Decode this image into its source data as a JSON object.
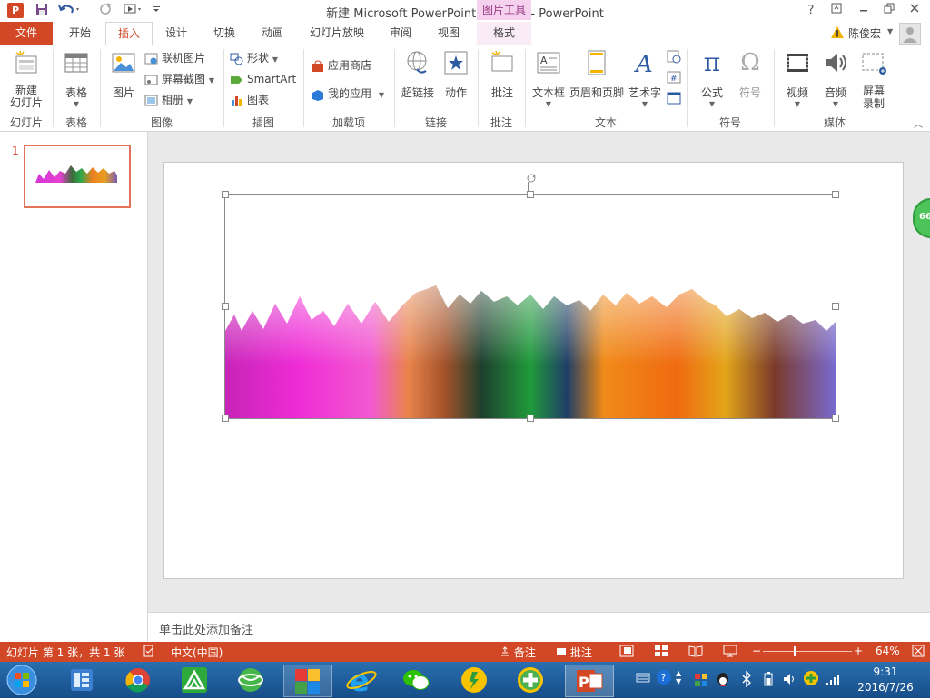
{
  "titlebar": {
    "title": "新建 Microsoft PowerPoint 演示文稿 - PowerPoint",
    "app_logo": "P",
    "context_tab": "图片工具",
    "help": "?",
    "icons": [
      "save-icon",
      "undo-icon",
      "redo-icon",
      "present-icon",
      "customize-qat-icon",
      "help-icon",
      "ribbon-display-icon",
      "minimize-icon",
      "restore-icon",
      "close-icon"
    ]
  },
  "tabs": [
    "文件",
    "开始",
    "插入",
    "设计",
    "切换",
    "动画",
    "幻灯片放映",
    "审阅",
    "视图",
    "格式"
  ],
  "active_tab": "插入",
  "user": {
    "name": "陈俊宏"
  },
  "ribbon": {
    "groups": {
      "slides": {
        "label": "幻灯片",
        "new_slide": "新建\n幻灯片"
      },
      "tables": {
        "label": "表格",
        "table": "表格"
      },
      "images": {
        "label": "图像",
        "picture": "图片",
        "online_picture": "联机图片",
        "screenshot": "屏幕截图",
        "album": "相册"
      },
      "illustrations": {
        "label": "插图",
        "shapes": "形状",
        "smartart": "SmartArt",
        "chart": "图表"
      },
      "addins": {
        "label": "加载项",
        "store": "应用商店",
        "my_apps": "我的应用"
      },
      "links": {
        "label": "链接",
        "hyperlink": "超链接",
        "action": "动作"
      },
      "comments": {
        "label": "批注",
        "comment": "批注"
      },
      "text": {
        "label": "文本",
        "textbox": "文本框",
        "header_footer": "页眉和页脚",
        "wordart": "艺术字"
      },
      "symbols": {
        "label": "符号",
        "equation": "公式",
        "symbol": "符号"
      },
      "media": {
        "label": "媒体",
        "video": "视频",
        "audio": "音频",
        "screen_recording": "屏幕\n录制"
      }
    }
  },
  "thumbnail": {
    "number": "1"
  },
  "notes_placeholder": "单击此处添加备注",
  "side_badge": "66",
  "statusbar": {
    "slide_info": "幻灯片 第 1 张，共 1 张",
    "language": "中文(中国)",
    "notes": "备注",
    "comments": "批注",
    "zoom": "64%",
    "zoom_fraction": 0.35
  },
  "taskbar": {
    "time": "9:31",
    "date": "2016/7/26",
    "apps": [
      "start-orb",
      "explorer-icon",
      "chrome-icon",
      "green-app-icon",
      "globe-app-icon",
      "puzzle-app-icon",
      "ie-icon",
      "wechat-icon",
      "music-app-icon",
      "plus-app-icon",
      "powerpoint-icon"
    ]
  },
  "colors": {
    "accent": "#d24726",
    "context": "#9c3a8a",
    "taskbar": "#1f5d9c"
  }
}
